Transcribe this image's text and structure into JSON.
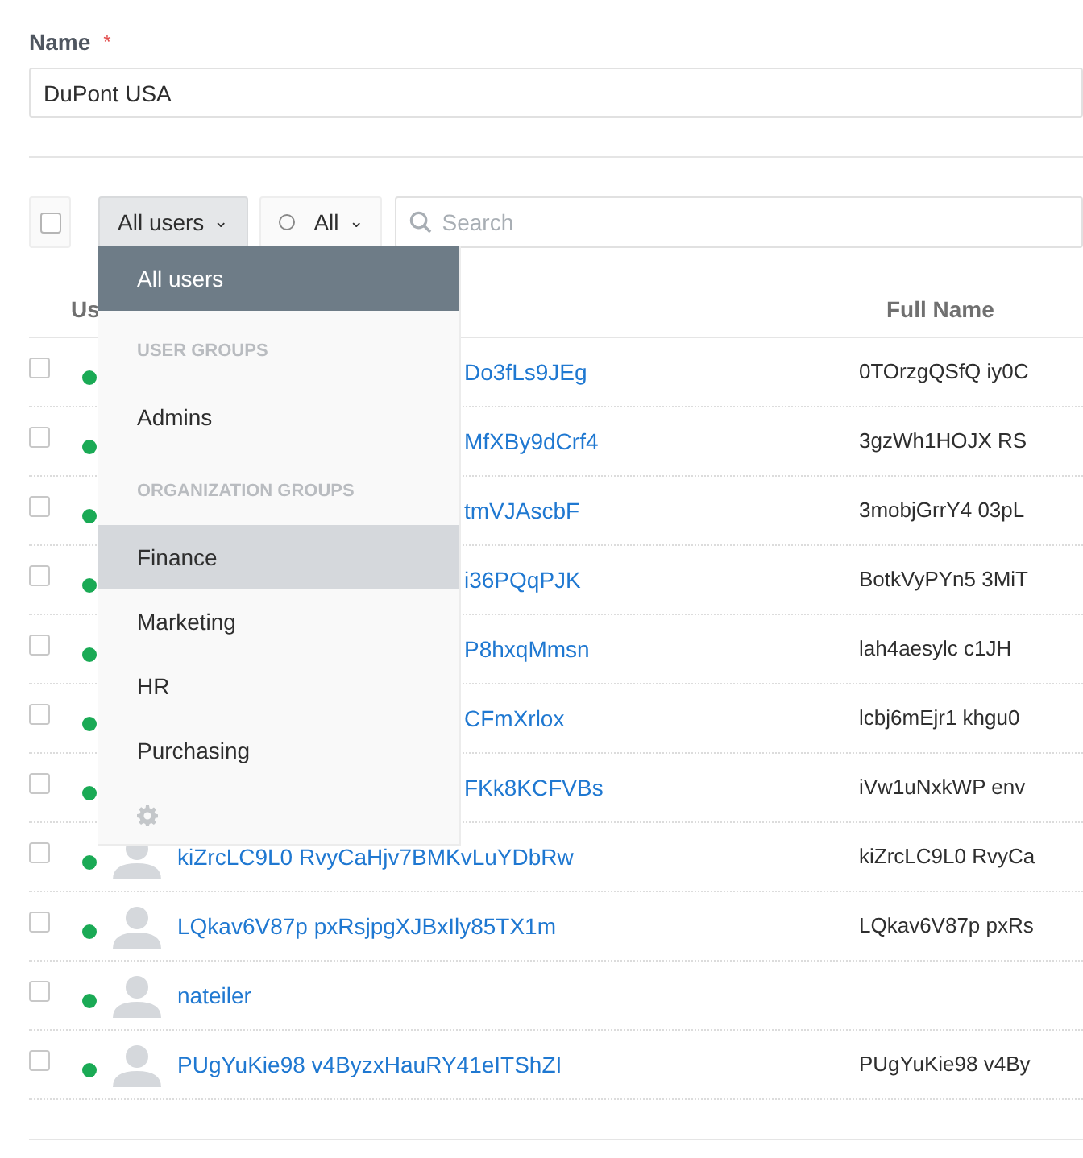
{
  "name_field": {
    "label": "Name",
    "required_mark": "*",
    "value": "DuPont USA"
  },
  "toolbar": {
    "select_all_checked": false,
    "group_filter": {
      "label": "All users",
      "caret": "⌄",
      "open": true
    },
    "status_filter": {
      "label": "All",
      "caret": "⌄"
    },
    "search": {
      "placeholder": "Search"
    }
  },
  "group_menu": [
    {
      "kind": "item",
      "label": "All users",
      "selected": true,
      "hovered": false
    },
    {
      "kind": "header",
      "label": "USER GROUPS"
    },
    {
      "kind": "item",
      "label": "Admins",
      "selected": false,
      "hovered": false
    },
    {
      "kind": "header",
      "label": "ORGANIZATION GROUPS"
    },
    {
      "kind": "item",
      "label": "Finance",
      "selected": false,
      "hovered": true
    },
    {
      "kind": "item",
      "label": "Marketing",
      "selected": false,
      "hovered": false
    },
    {
      "kind": "item",
      "label": "HR",
      "selected": false,
      "hovered": false
    },
    {
      "kind": "item",
      "label": "Purchasing",
      "selected": false,
      "hovered": false
    },
    {
      "kind": "settings"
    }
  ],
  "table": {
    "columns": [
      "Us",
      "Full Name"
    ],
    "rows": [
      {
        "checked": false,
        "username": "Do3fLs9JEg",
        "full_name": "0TOrzgQSfQ iy0C"
      },
      {
        "checked": false,
        "username": "MfXBy9dCrf4",
        "full_name": "3gzWh1HOJX RS"
      },
      {
        "checked": false,
        "username": "tmVJAscbF",
        "full_name": "3mobjGrrY4 03pL"
      },
      {
        "checked": false,
        "username": "i36PQqPJK",
        "full_name": "BotkVyPYn5 3MiT"
      },
      {
        "checked": false,
        "username": "P8hxqMmsn",
        "full_name": "lah4aesylc c1JH"
      },
      {
        "checked": false,
        "username": "CFmXrlox",
        "full_name": "lcbj6mEjr1 khgu0"
      },
      {
        "checked": false,
        "username": "FKk8KCFVBs",
        "full_name": "iVw1uNxkWP env"
      },
      {
        "checked": false,
        "username": "kiZrcLC9L0 RvyCaHjv7BMKvLuYDbRw",
        "full_name": "kiZrcLC9L0 RvyCa"
      },
      {
        "checked": false,
        "username": "LQkav6V87p pxRsjpgXJBxIly85TX1m",
        "full_name": "LQkav6V87p pxRs"
      },
      {
        "checked": false,
        "username": "nateiler"
      },
      {
        "checked": false,
        "username": "PUgYuKie98 v4ByzxHauRY41eITShZI",
        "full_name": "PUgYuKie98 v4By"
      }
    ]
  }
}
